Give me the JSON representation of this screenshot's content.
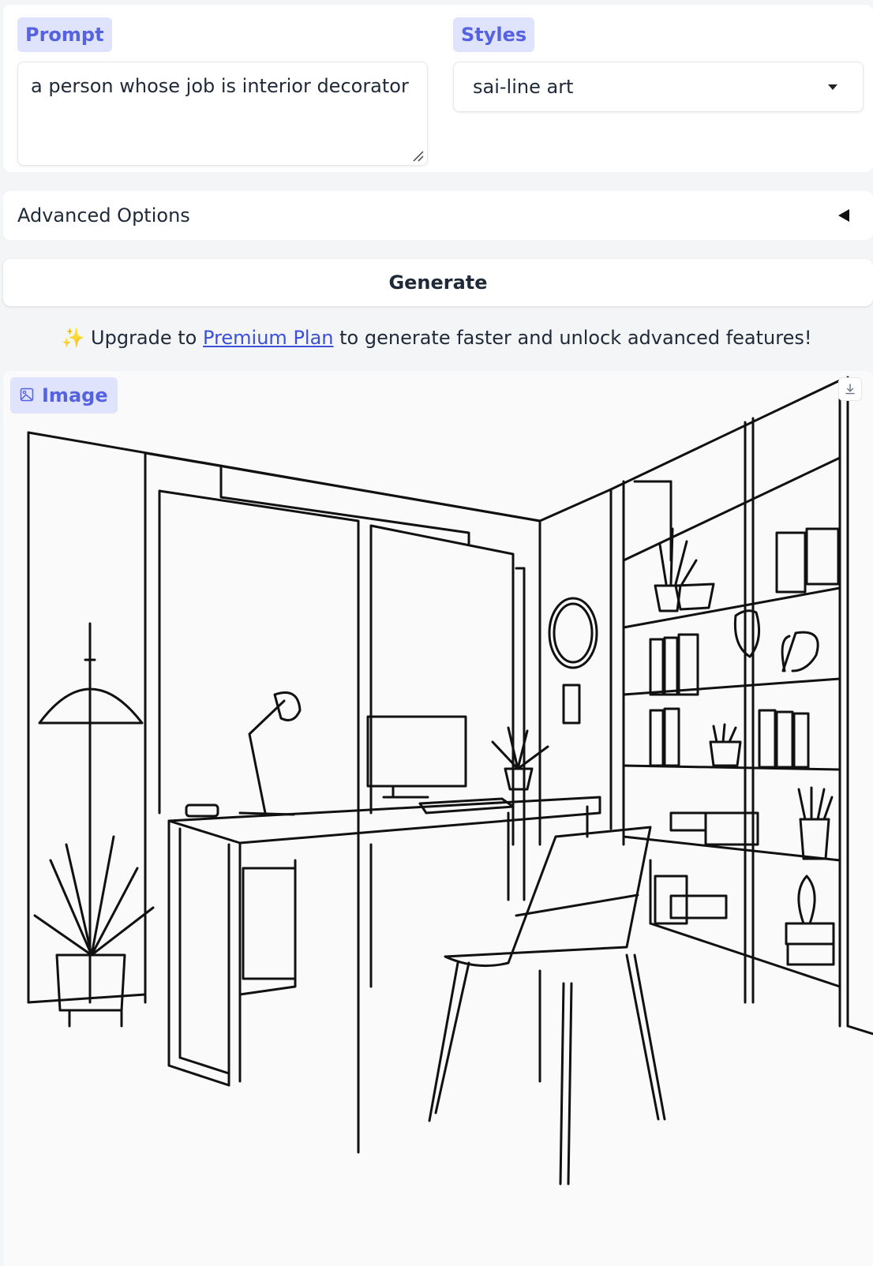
{
  "prompt": {
    "label": "Prompt",
    "value": "a person whose job is interior decorator"
  },
  "styles": {
    "label": "Styles",
    "selected": "sai-line art"
  },
  "advanced": {
    "label": "Advanced Options"
  },
  "generate": {
    "label": "Generate"
  },
  "upgrade": {
    "sparkle": "✨",
    "prefix": "Upgrade to",
    "link": "Premium Plan",
    "suffix": "to generate faster and unlock advanced features!"
  },
  "output": {
    "label": "Image"
  },
  "colors": {
    "accent": "#5563e0",
    "badge_bg": "#dfe3fb",
    "link": "#3b4fd8"
  }
}
